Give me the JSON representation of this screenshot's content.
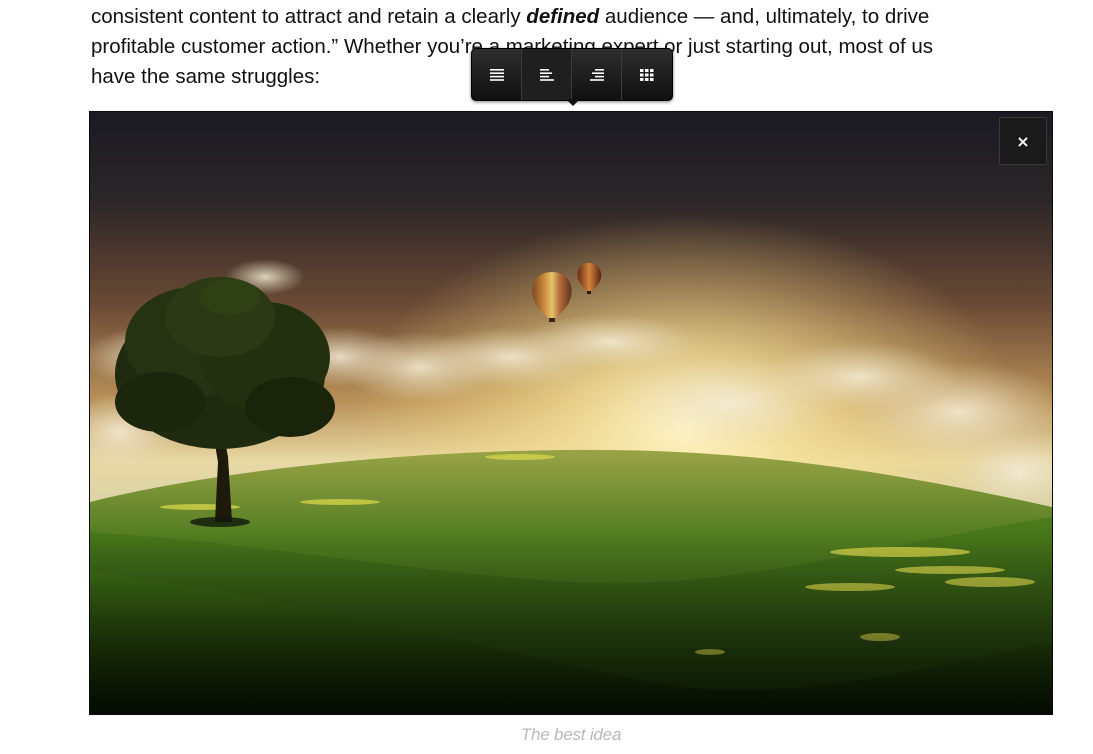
{
  "paragraph": {
    "line1_pre": "consistent content to attract and retain a clearly ",
    "line1_em": "defined",
    "line1_post": " audience — and, ultimately, to drive",
    "line2": "profitable customer action.” Whether you’re a marketing expert or just starting out, most of us",
    "line3": "have the same struggles:"
  },
  "image_toolbar": {
    "buttons": [
      {
        "icon": "align-justify-icon",
        "active": false
      },
      {
        "icon": "align-left-icon",
        "active": true
      },
      {
        "icon": "align-right-icon",
        "active": false
      },
      {
        "icon": "grid-icon",
        "active": false
      }
    ]
  },
  "figure": {
    "close_label": "×",
    "caption": "The best idea"
  },
  "colors": {
    "toolbar_bg": "#1a1a1a",
    "caption": "#b8b8b8",
    "text": "#111111"
  }
}
